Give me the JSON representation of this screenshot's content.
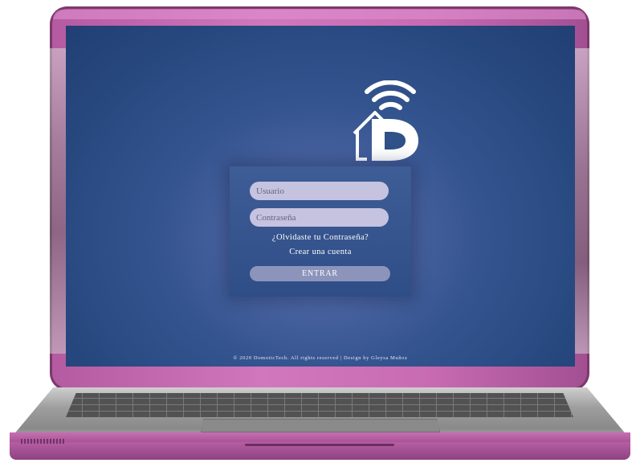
{
  "app": {
    "brand_name": "Domotic Tech",
    "logo_icon": "smart-home-wifi-logo-icon"
  },
  "login": {
    "username_placeholder": "Usuario",
    "password_placeholder": "Contraseña",
    "forgot_password_link": "¿Olvidaste tu Contraseña?",
    "create_account_link": "Crear una cuenta",
    "submit_label": "ENTRAR"
  },
  "footer": {
    "text": "© 2020 DomoticTech. All rights reserved | Design by Gleysa Muñoz"
  },
  "colors": {
    "screen_bg": "#2b4a83",
    "laptop_shell": "#c86bb3",
    "input_bg": "#c6c3e0",
    "button_bg": "#8d94bb"
  }
}
